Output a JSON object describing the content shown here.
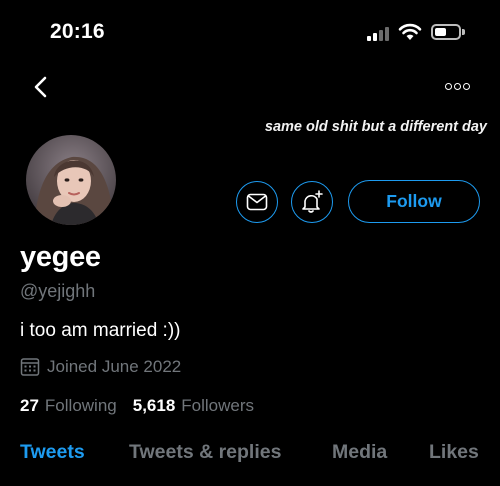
{
  "status_bar": {
    "time": "20:16"
  },
  "header": {
    "banner_caption": "same old shit but a different day"
  },
  "profile": {
    "display_name": "yegee",
    "handle": "@yejighh",
    "bio": "i too am married :))",
    "joined": "Joined June 2022",
    "following_count": "27",
    "following_label": "Following",
    "followers_count": "5,618",
    "followers_label": "Followers"
  },
  "actions": {
    "follow_label": "Follow"
  },
  "tabs": [
    {
      "label": "Tweets",
      "active": true
    },
    {
      "label": "Tweets & replies",
      "active": false
    },
    {
      "label": "Media",
      "active": false
    },
    {
      "label": "Likes",
      "active": false
    }
  ],
  "colors": {
    "accent": "#1d9bf0",
    "background": "#000000",
    "muted_text": "#71767b"
  },
  "icons": [
    "signal-icon",
    "wifi-icon",
    "battery-icon",
    "back-arrow-icon",
    "more-options-icon",
    "message-icon",
    "notification-bell-icon",
    "calendar-icon"
  ]
}
